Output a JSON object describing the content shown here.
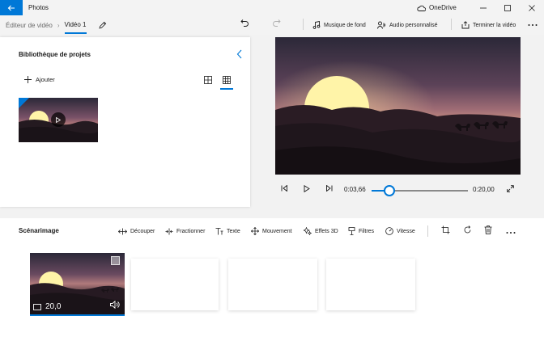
{
  "titlebar": {
    "app_title": "Photos",
    "onedrive_label": "OneDrive"
  },
  "commandbar": {
    "breadcrumb_parent": "Éditeur de vidéo",
    "breadcrumb_current": "Vidéo 1",
    "actions": {
      "music": "Musique de fond",
      "custom_audio": "Audio personnalisé",
      "finish": "Terminer la vidéo"
    }
  },
  "library": {
    "title": "Bibliothèque de projets",
    "add_label": "Ajouter"
  },
  "player": {
    "current_time": "0:03,66",
    "total_time": "0:20,00",
    "progress": 0.183
  },
  "storyboard": {
    "title": "Scénarimage",
    "tools": {
      "trim": "Découper",
      "split": "Fractionner",
      "text": "Texte",
      "motion": "Mouvement",
      "effects3d": "Effets 3D",
      "filters": "Filtres",
      "speed": "Vitesse"
    },
    "clip": {
      "duration": "20,0"
    }
  },
  "colors": {
    "accent": "#0078d7",
    "sunset_sky_top": "#2b2838",
    "sunset_sky_mid": "#8a5a6e",
    "sun": "#fff4a8"
  }
}
